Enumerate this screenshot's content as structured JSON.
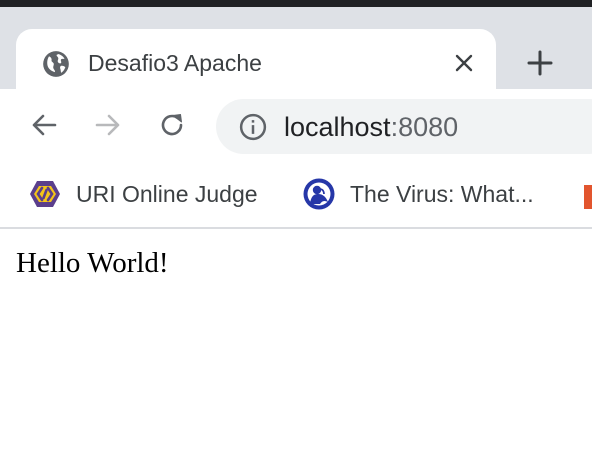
{
  "browser": {
    "tab": {
      "title": "Desafio3 Apache",
      "favicon": "globe-icon",
      "close_icon": "close-icon"
    },
    "new_tab_icon": "plus-icon",
    "nav": {
      "back_icon": "arrow-left-icon",
      "forward_icon": "arrow-right-icon",
      "forward_enabled": false,
      "reload_icon": "reload-icon"
    },
    "omnibox": {
      "security_icon": "info-icon",
      "host": "localhost",
      "port": ":8080"
    },
    "bookmarks": [
      {
        "label": "URI Online Judge",
        "icon": "uri-logo-icon"
      },
      {
        "label": "The Virus: What...",
        "icon": "pbs-logo-icon"
      }
    ]
  },
  "page": {
    "heading": "Hello World!"
  },
  "colors": {
    "tabstrip_bg": "#dee1e6",
    "omnibox_bg": "#f1f3f4",
    "text": "#3c4043",
    "icon": "#5f6368",
    "disabled_icon": "#b8b9bb"
  }
}
